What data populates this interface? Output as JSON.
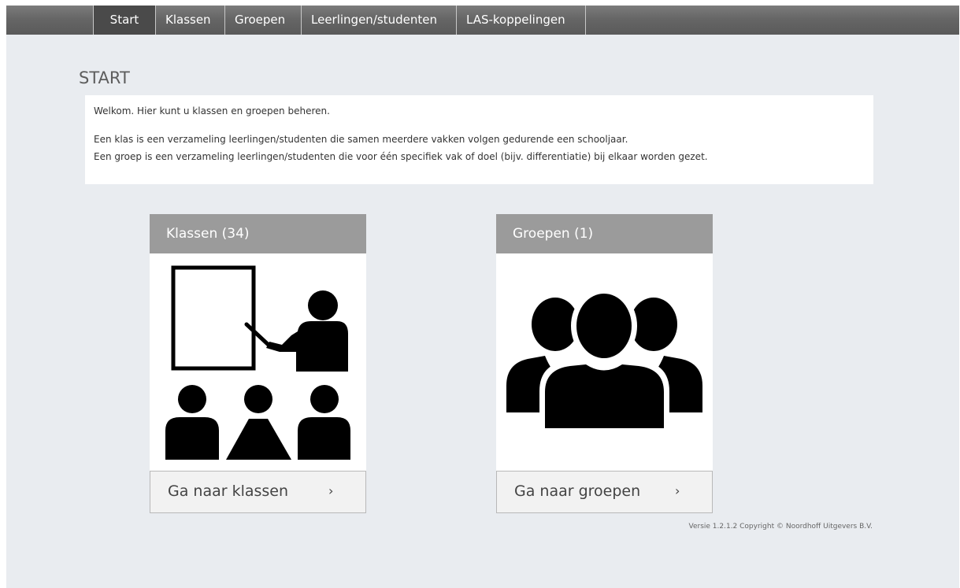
{
  "nav": {
    "tabs": [
      {
        "label": "Start",
        "active": true
      },
      {
        "label": "Klassen",
        "active": false
      },
      {
        "label": "Groepen",
        "active": false
      },
      {
        "label": "Leerlingen/studenten",
        "active": false
      },
      {
        "label": "LAS-koppelingen",
        "active": false
      }
    ]
  },
  "page": {
    "title": "START",
    "intro": {
      "line1": "Welkom. Hier kunt u klassen en groepen beheren.",
      "line2": "Een klas is een verzameling leerlingen/studenten die samen meerdere vakken volgen gedurende een schooljaar.",
      "line3": "Een groep is een verzameling leerlingen/studenten die voor één specifiek vak of doel (bijv. differentiatie) bij elkaar worden gezet."
    }
  },
  "cards": {
    "klassen": {
      "header": "Klassen (34)",
      "button": "Ga naar klassen",
      "chevron": "›",
      "icon": "classroom-teacher-icon"
    },
    "groepen": {
      "header": "Groepen (1)",
      "button": "Ga naar groepen",
      "chevron": "›",
      "icon": "group-people-icon"
    }
  },
  "footer": {
    "text": "Versie 1.2.1.2 Copyright © Noordhoff Uitgevers B.V."
  },
  "colors": {
    "nav_bg": "#666666",
    "page_bg": "#e9ecf0",
    "card_header_bg": "#9b9b9b",
    "icon": "#000000"
  }
}
